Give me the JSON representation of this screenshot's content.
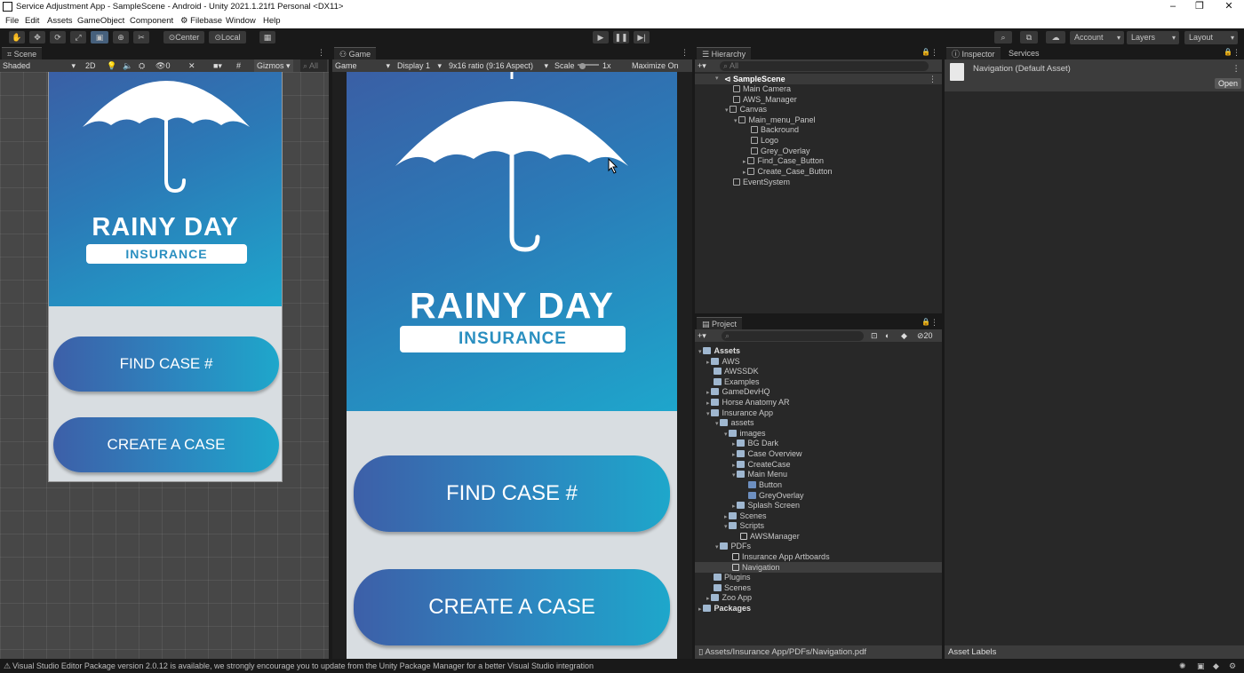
{
  "window": {
    "title": "Service Adjustment App - SampleScene - Android - Unity 2021.1.21f1 Personal <DX11>"
  },
  "menu": [
    "File",
    "Edit",
    "Assets",
    "GameObject",
    "Component",
    "Filebase",
    "Window",
    "Help"
  ],
  "toolbar": {
    "pivot": "Center",
    "space": "Local",
    "account": "Account",
    "layers": "Layers",
    "layout": "Layout"
  },
  "scene_panel": {
    "tab": "Scene",
    "shading": "Shaded",
    "mode_2d": "2D",
    "gizmos": "Gizmos",
    "hidden_count": "0"
  },
  "game_panel": {
    "tab": "Game",
    "display_type": "Game",
    "display": "Display 1",
    "aspect": "9x16 ratio (9:16 Aspect)",
    "scale_label": "Scale",
    "scale_value": "1x",
    "maximize": "Maximize On Pla"
  },
  "app_ui": {
    "brand_title": "RAINY DAY",
    "brand_subtitle": "INSURANCE",
    "find_button": "FIND CASE #",
    "create_button": "CREATE A CASE"
  },
  "hierarchy": {
    "tab": "Hierarchy",
    "search_placeholder": "All",
    "items": [
      {
        "label": "SampleScene"
      },
      {
        "label": "Main Camera"
      },
      {
        "label": "AWS_Manager"
      },
      {
        "label": "Canvas"
      },
      {
        "label": "Main_menu_Panel"
      },
      {
        "label": "Backround"
      },
      {
        "label": "Logo"
      },
      {
        "label": "Grey_Overlay"
      },
      {
        "label": "Find_Case_Button"
      },
      {
        "label": "Create_Case_Button"
      },
      {
        "label": "EventSystem"
      }
    ]
  },
  "project": {
    "tab": "Project",
    "hidden_count": "20",
    "items": [
      {
        "label": "Assets"
      },
      {
        "label": "AWS"
      },
      {
        "label": "AWSSDK"
      },
      {
        "label": "Examples"
      },
      {
        "label": "GameDevHQ"
      },
      {
        "label": "Horse Anatomy AR"
      },
      {
        "label": "Insurance App"
      },
      {
        "label": "assets"
      },
      {
        "label": "images"
      },
      {
        "label": "BG Dark"
      },
      {
        "label": "Case Overview"
      },
      {
        "label": "CreateCase"
      },
      {
        "label": "Main Menu"
      },
      {
        "label": "Button"
      },
      {
        "label": "GreyOverlay"
      },
      {
        "label": "Splash Screen"
      },
      {
        "label": "Scenes"
      },
      {
        "label": "Scripts"
      },
      {
        "label": "AWSManager"
      },
      {
        "label": "PDFs"
      },
      {
        "label": "Insurance App Artboards"
      },
      {
        "label": "Navigation"
      },
      {
        "label": "Plugins"
      },
      {
        "label": "Scenes"
      },
      {
        "label": "Zoo App"
      },
      {
        "label": "Packages"
      }
    ],
    "path": "Assets/Insurance App/PDFs/Navigation.pdf"
  },
  "inspector": {
    "tab": "Inspector",
    "tab2": "Services",
    "asset_name": "Navigation (Default Asset)",
    "open_button": "Open",
    "asset_labels": "Asset Labels"
  },
  "status": {
    "message": "Visual Studio Editor Package version 2.0.12 is available, we strongly encourage you to update from the Unity Package Manager for a better Visual Studio integration"
  },
  "colors": {
    "editor_bg": "#282828",
    "accent_blue": "#46607c",
    "brand_gradient_start": "#3a5fa5",
    "brand_gradient_end": "#1ea6cc"
  }
}
